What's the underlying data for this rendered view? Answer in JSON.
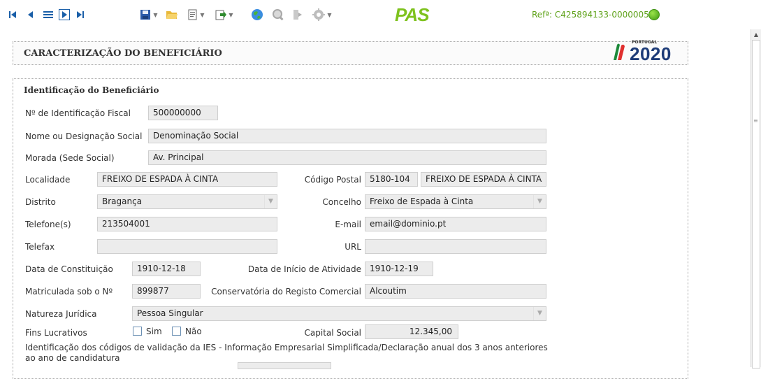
{
  "toolbar": {
    "nav_first": "⏮",
    "nav_prev": "◀",
    "nav_list": "≡",
    "nav_next": "▷",
    "nav_last": "⏭",
    "pas_logo": "PAS",
    "reference": "Refª: C425894133-00000057",
    "icons": [
      "first-record-icon",
      "previous-record-icon",
      "list-icon",
      "next-record-icon",
      "last-record-icon",
      "save-icon",
      "open-folder-icon",
      "document-icon",
      "export-icon",
      "globe-icon",
      "search-icon",
      "exit-icon",
      "gear-icon",
      "pas-logo",
      "status-green-icon"
    ]
  },
  "header": {
    "title": "CARACTERIZAÇÃO DO BENEFICIÁRIO",
    "logo_small": "PORTUGAL",
    "logo_year": "2020"
  },
  "section": {
    "title": "Identificação do Beneficiário"
  },
  "form": {
    "nif_label": "Nº de Identificação Fiscal",
    "nif": "500000000",
    "name_label": "Nome ou Designação Social",
    "name": "Denominação Social",
    "address_label": "Morada (Sede Social)",
    "address": "Av. Principal",
    "locality_label": "Localidade",
    "locality": "FREIXO DE ESPADA À CINTA",
    "postal_label": "Código Postal",
    "postal_code": "5180-104",
    "postal_locality": "FREIXO DE ESPADA À CINTA",
    "district_label": "Distrito",
    "district": "Bragança",
    "municipality_label": "Concelho",
    "municipality": "Freixo de Espada à Cinta",
    "phone_label": "Telefone(s)",
    "phone": "213504001",
    "email_label": "E-mail",
    "email": "email@dominio.pt",
    "fax_label": "Telefax",
    "fax": "",
    "url_label": "URL",
    "url": "",
    "constitution_label": "Data de Constituição",
    "constitution_date": "1910-12-18",
    "activity_label": "Data de Início de Atividade",
    "activity_date": "1910-12-19",
    "registration_label": "Matriculada sob o Nº",
    "registration": "899877",
    "registry_office_label": "Conservatória do Registo Comercial",
    "registry_office": "Alcoutim",
    "legal_nature_label": "Natureza Jurídica",
    "legal_nature": "Pessoa Singular",
    "profit_label": "Fins Lucrativos",
    "profit_yes": "Sim",
    "profit_no": "Não",
    "capital_label": "Capital Social",
    "capital": "12.345,00",
    "ies_text": "Identificação dos códigos de validação da IES - Informação Empresarial Simplificada/Declaração anual dos 3 anos anteriores ao ano de candidatura"
  }
}
